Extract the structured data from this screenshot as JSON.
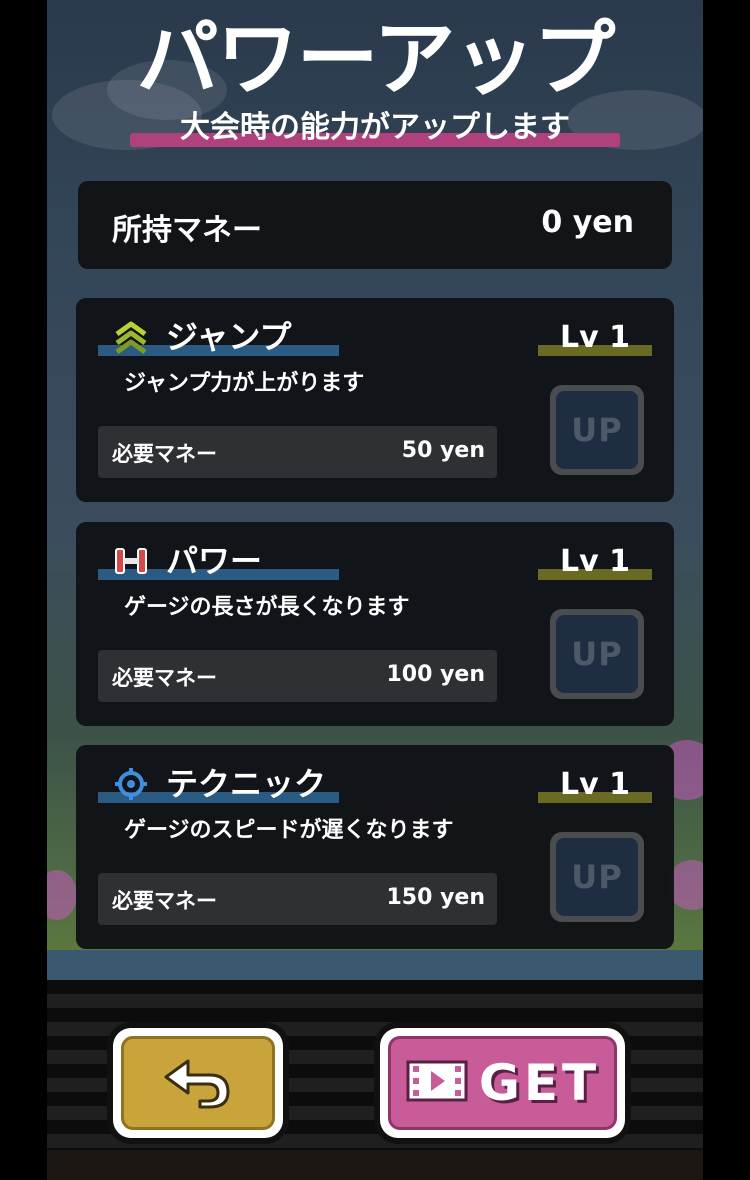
{
  "header": {
    "title": "パワーアップ",
    "subtitle": "大会時の能力がアップします"
  },
  "wallet": {
    "label": "所持マネー",
    "value": "0 yen"
  },
  "upgrades": [
    {
      "name": "ジャンプ",
      "icon": "chevron-up-icon",
      "level": "Lv 1",
      "description": "ジャンプ力が上がります",
      "cost_label": "必要マネー",
      "cost": "50 yen",
      "button_label": "UP"
    },
    {
      "name": "パワー",
      "icon": "dumbbell-icon",
      "level": "Lv 1",
      "description": "ゲージの長さが長くなります",
      "cost_label": "必要マネー",
      "cost": "100 yen",
      "button_label": "UP"
    },
    {
      "name": "テクニック",
      "icon": "crosshair-icon",
      "level": "Lv 1",
      "description": "ゲージのスピードが遅くなります",
      "cost_label": "必要マネー",
      "cost": "150 yen",
      "button_label": "UP"
    }
  ],
  "footer": {
    "back_icon": "back-arrow-icon",
    "get_icon": "film-video-icon",
    "get_label": "GET"
  },
  "colors": {
    "subtitle_underline": "#b0417d",
    "name_underline": "#2b5a82",
    "level_underline": "#6a6a22",
    "back_button": "#c8a43a",
    "get_button": "#c85c98"
  }
}
